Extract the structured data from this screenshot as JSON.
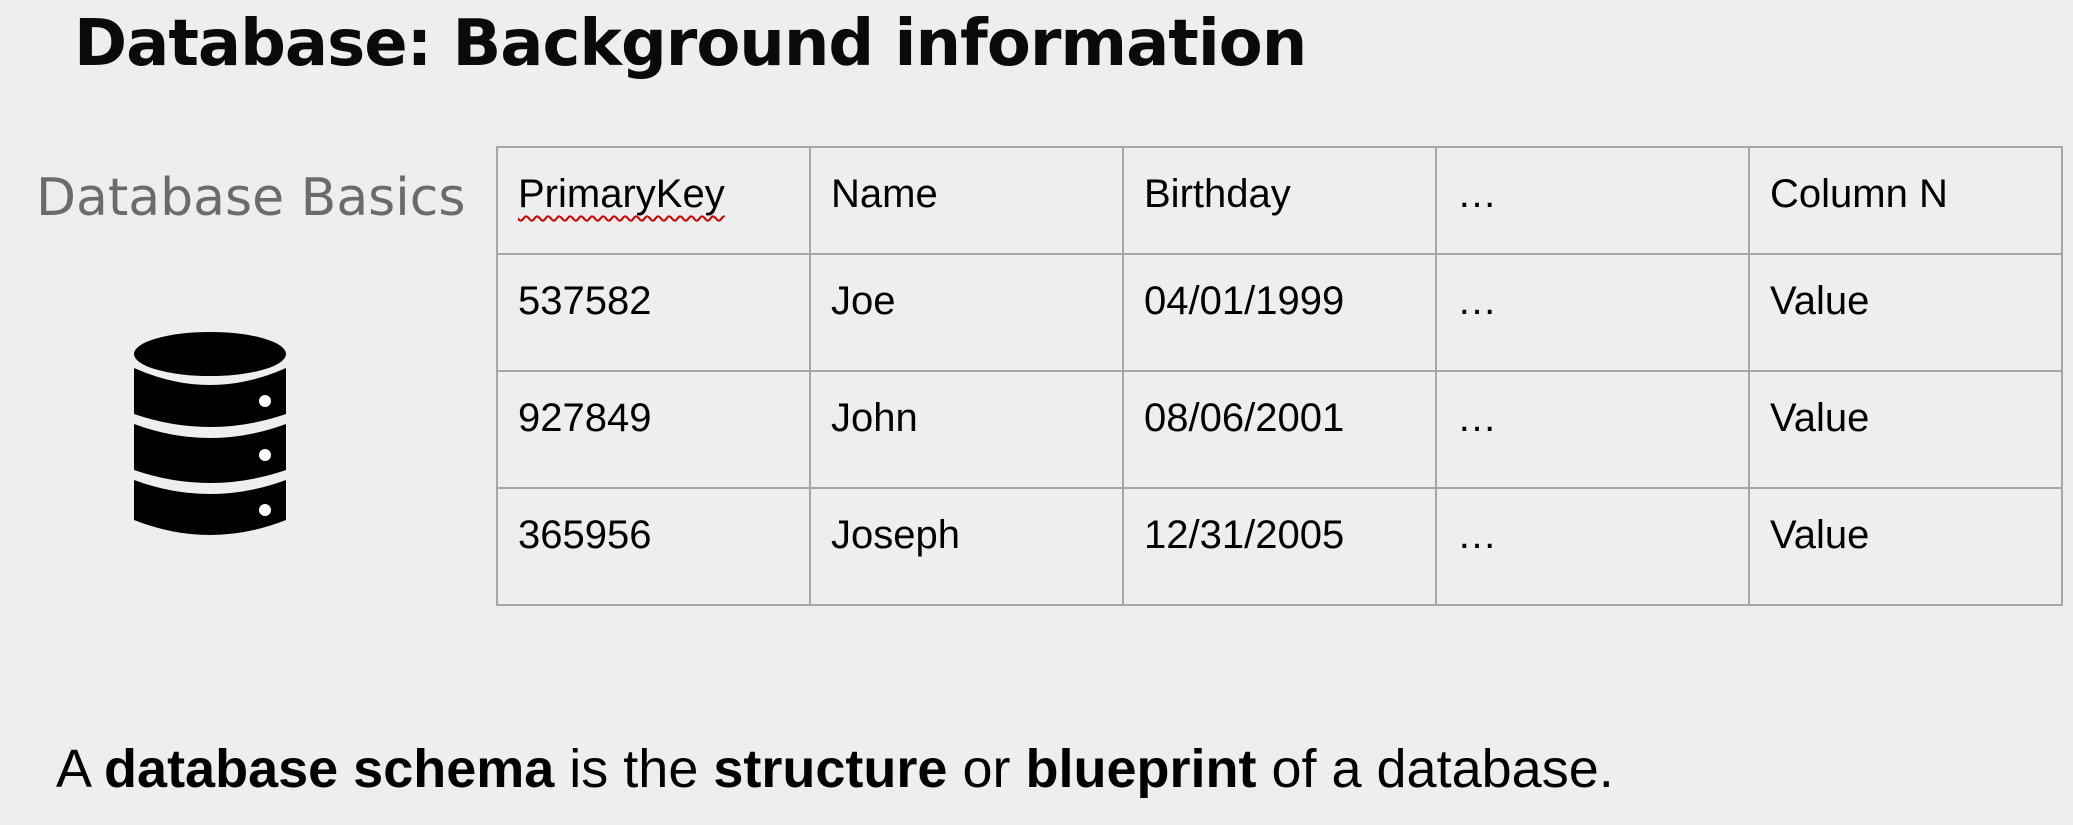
{
  "slide": {
    "title": "Database: Background information",
    "subtitle": "Database Basics",
    "icon": "database-icon"
  },
  "table": {
    "headers": [
      "PrimaryKey",
      "Name",
      "Birthday",
      "…",
      "Column N"
    ],
    "rows": [
      [
        "537582",
        "Joe",
        "04/01/1999",
        "…",
        "Value"
      ],
      [
        "927849",
        "John",
        "08/06/2001",
        "…",
        "Value"
      ],
      [
        "365956",
        "Joseph",
        "12/31/2005",
        "…",
        "Value"
      ]
    ]
  },
  "statement": {
    "part1": "A ",
    "part2": "database schema",
    "part3": " is the ",
    "part4": "structure",
    "part5": " or ",
    "part6": "blueprint",
    "part7": " of a database."
  }
}
